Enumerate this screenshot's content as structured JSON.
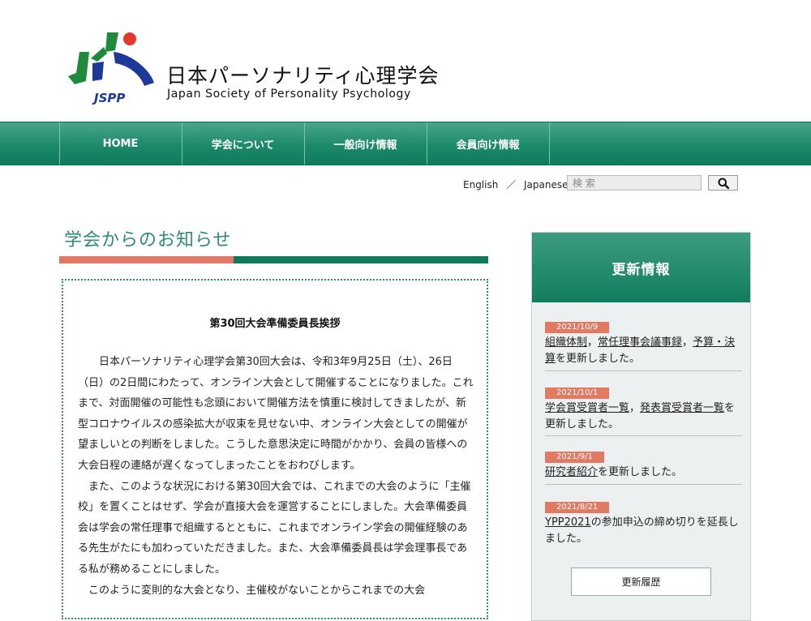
{
  "header": {
    "title": "日本パーソナリティ心理学会",
    "subtitle": "Japan Society of Personality Psychology",
    "logo_text": "JSPP"
  },
  "nav": {
    "items": [
      "HOME",
      "学会について",
      "一般向け情報",
      "会員向け情報"
    ]
  },
  "lang": {
    "english": "English",
    "separator": "／",
    "japanese": "Japanese"
  },
  "search": {
    "placeholder": "検 索",
    "icon": "search-icon"
  },
  "main": {
    "section_title": "学会からのお知らせ",
    "notice": {
      "title": "第30回大会準備委員長挨拶",
      "paragraphs": [
        "日本パーソナリティ心理学会第30回大会は、令和3年9月25日（土）、26日（日）の2日間にわたって、オンライン大会として開催することになりました。これまで、対面開催の可能性も念頭において開催方法を慎重に検討してきましたが、新型コロナウイルスの感染拡大が収束を見せない中、オンライン大会としての開催が望ましいとの判断をしました。こうした意思決定に時間がかかり、会員の皆様への大会日程の連絡が遅くなってしまったことをおわびします。",
        "また、このような状況における第30回大会では、これまでの大会のように「主催校」を置くことはせず、学会が直接大会を運営することにしました。大会準備委員会は学会の常任理事で組織するとともに、これまでオンライン学会の開催経験のある先生がたにも加わっていただきました。また、大会準備委員長は学会理事長である私が務めることにしました。",
        "このように変則的な大会となり、主催校がないことからこれまでの大会"
      ]
    }
  },
  "sidebar": {
    "title": "更新情報",
    "updates": [
      {
        "date": "2021/10/9",
        "links": [
          "組織体制",
          "常任理事会議事録",
          "予算・決算"
        ],
        "seps": [
          "，",
          "，"
        ],
        "suffix": "を更新しました。"
      },
      {
        "date": "2021/10/1",
        "links": [
          "学会賞受賞者一覧",
          "発表賞受賞者一覧"
        ],
        "seps": [
          "，"
        ],
        "suffix": "を更新しました。"
      },
      {
        "date": "2021/9/1",
        "links": [
          "研究者紹介"
        ],
        "seps": [],
        "suffix": "を更新しました。"
      },
      {
        "date": "2021/8/21",
        "links": [
          "YPP2021"
        ],
        "seps": [],
        "suffix": "の参加申込の締め切りを延長しました。"
      }
    ],
    "history_button": "更新履歴"
  },
  "colors": {
    "brand_green": "#0f7a5c",
    "accent_orange": "#e27a63",
    "logo_blue": "#1d3a9a"
  }
}
